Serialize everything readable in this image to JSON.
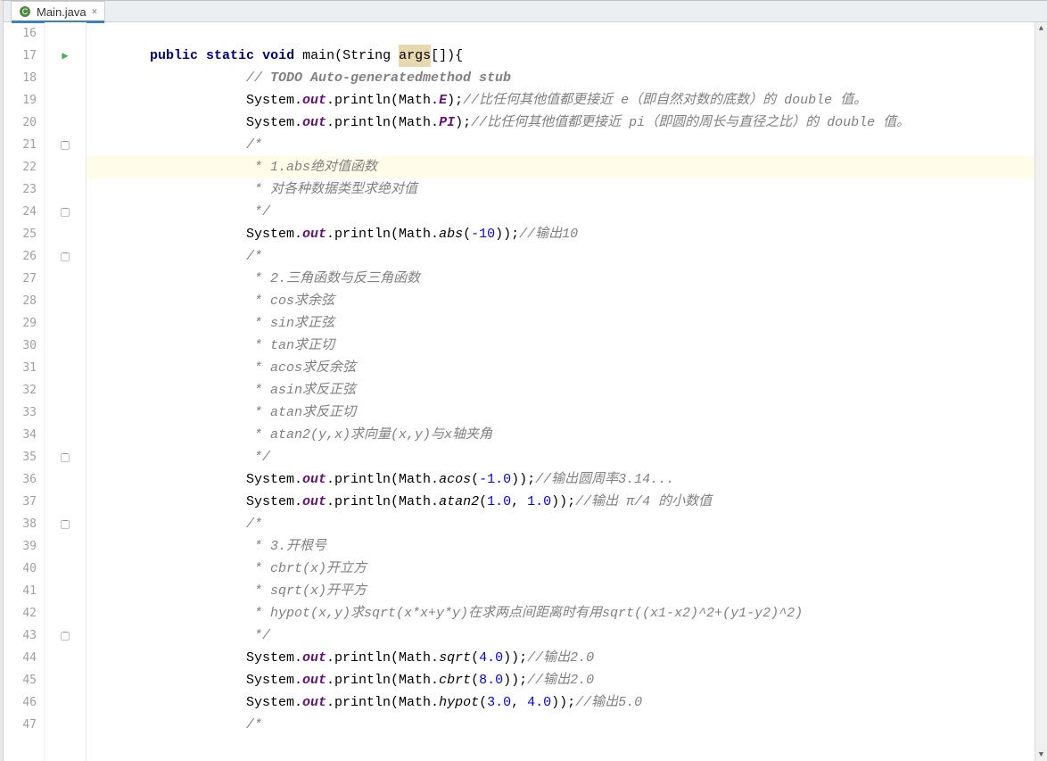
{
  "tab": {
    "label": "Main.java"
  },
  "line_numbers": [
    "16",
    "17",
    "18",
    "19",
    "20",
    "21",
    "22",
    "23",
    "24",
    "25",
    "26",
    "27",
    "28",
    "29",
    "30",
    "31",
    "32",
    "33",
    "34",
    "35",
    "36",
    "37",
    "38",
    "39",
    "40",
    "41",
    "42",
    "43",
    "44",
    "45",
    "46",
    "47"
  ],
  "code": {
    "l16": "",
    "l17_kw1": "public",
    "l17_kw2": "static",
    "l17_kw3": "void",
    "l17_main": " main(String ",
    "l17_args": "args",
    "l17_tail": "[]){",
    "l18_c1": "// ",
    "l18_c2": "TODO Auto-generatedmethod stub",
    "l19_a": "System.",
    "l19_out": "out",
    "l19_b": ".println(Math.",
    "l19_E": "E",
    "l19_c": ");",
    "l19_cmt": "//比任何其他值都更接近 e（即自然对数的底数）的 double 值。",
    "l20_a": "System.",
    "l20_out": "out",
    "l20_b": ".println(Math.",
    "l20_PI": "PI",
    "l20_c": ");",
    "l20_cmt": "//比任何其他值都更接近 pi（即圆的周长与直径之比）的 double 值。",
    "l21": "/*",
    "l22": " * 1.abs绝对值函数",
    "l23": " * 对各种数据类型求绝对值",
    "l24": " */",
    "l25_a": "System.",
    "l25_out": "out",
    "l25_b": ".println(Math.",
    "l25_m": "abs",
    "l25_p1": "(",
    "l25_n": "-10",
    "l25_p2": "));",
    "l25_cmt": "//输出10",
    "l26": "/*",
    "l27": " * 2.三角函数与反三角函数",
    "l28": " * cos求余弦",
    "l29": " * sin求正弦",
    "l30": " * tan求正切",
    "l31": " * acos求反余弦",
    "l32": " * asin求反正弦",
    "l33": " * atan求反正切",
    "l34": " * atan2(y,x)求向量(x,y)与x轴夹角",
    "l35": " */",
    "l36_a": "System.",
    "l36_out": "out",
    "l36_b": ".println(Math.",
    "l36_m": "acos",
    "l36_p1": "(",
    "l36_n": "-1.0",
    "l36_p2": "));",
    "l36_cmt": "//输出圆周率3.14...",
    "l37_a": "System.",
    "l37_out": "out",
    "l37_b": ".println(Math.",
    "l37_m": "atan2",
    "l37_p1": "(",
    "l37_n1": "1.0",
    "l37_comma": ", ",
    "l37_n2": "1.0",
    "l37_p2": "));",
    "l37_cmt": "//输出 π/4 的小数值",
    "l38": "/*",
    "l39": " * 3.开根号",
    "l40": " * cbrt(x)开立方",
    "l41": " * sqrt(x)开平方",
    "l42": " * hypot(x,y)求sqrt(x*x+y*y)在求两点间距离时有用sqrt((x1-x2)^2+(y1-y2)^2)",
    "l43": " */",
    "l44_a": "System.",
    "l44_out": "out",
    "l44_b": ".println(Math.",
    "l44_m": "sqrt",
    "l44_p1": "(",
    "l44_n": "4.0",
    "l44_p2": "));",
    "l44_cmt": "//输出2.0",
    "l45_a": "System.",
    "l45_out": "out",
    "l45_b": ".println(Math.",
    "l45_m": "cbrt",
    "l45_p1": "(",
    "l45_n": "8.0",
    "l45_p2": "));",
    "l45_cmt": "//输出2.0",
    "l46_a": "System.",
    "l46_out": "out",
    "l46_b": ".println(Math.",
    "l46_m": "hypot",
    "l46_p1": "(",
    "l46_n1": "3.0",
    "l46_comma": ", ",
    "l46_n2": "4.0",
    "l46_p2": "));",
    "l46_cmt": "//输出5.0",
    "l47": "/*"
  }
}
